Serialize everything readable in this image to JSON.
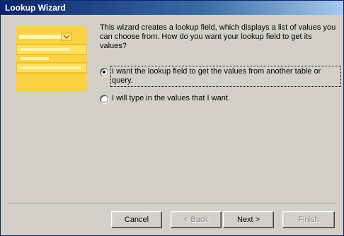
{
  "window": {
    "title": "Lookup Wizard"
  },
  "intro": "This wizard creates a lookup field, which displays a list of values you can choose from.  How do you want your lookup field to get its values?",
  "options": [
    {
      "label": "I want the lookup field to get the values from another table or query.",
      "checked": true
    },
    {
      "label": "I will type in the values that I want.",
      "checked": false
    }
  ],
  "buttons": {
    "cancel": "Cancel",
    "back": "< Back",
    "next": "Next >",
    "finish": "Finish"
  },
  "colors": {
    "titlebar_start": "#0a246a",
    "titlebar_end": "#a6caf0",
    "dialog_bg": "#d4d0c8",
    "illustration_yellow": "#ffd84a"
  }
}
